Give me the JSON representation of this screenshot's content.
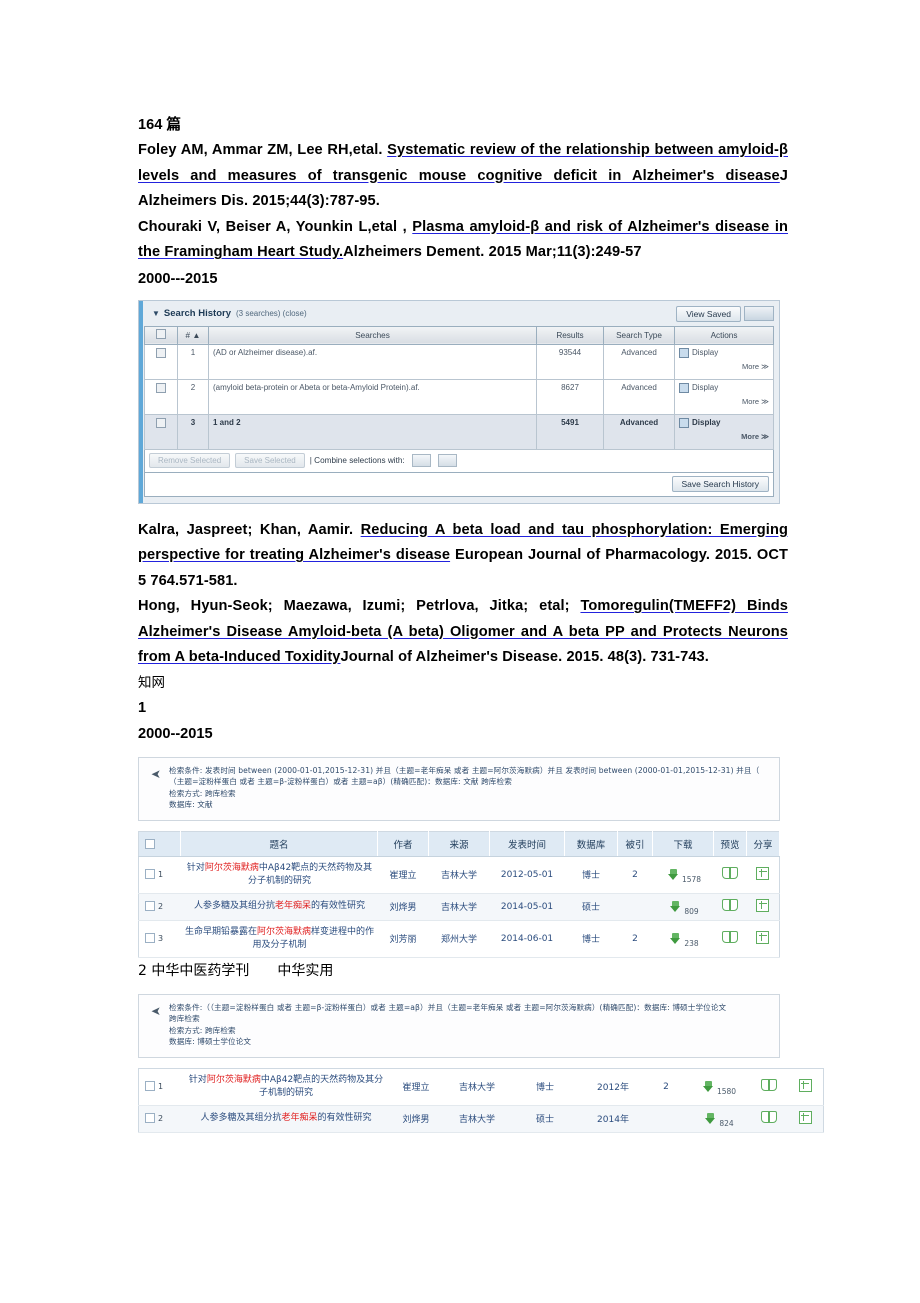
{
  "document": {
    "count_line": "164 篇",
    "year_range_1": "2000---2015",
    "zhiwang_label": "知网",
    "section_1_number": "1",
    "year_range_2": "2000--2015",
    "section_2_label": "2 中华中医药学刊　　中华实用"
  },
  "references": [
    {
      "id": "ref-foley",
      "authors": "Foley AM,  Ammar ZM,  Lee RH,etal. ",
      "title": "Systematic review of  the  relationship between amyloid-β levels and  measures of  transgenic mouse cognitive deficit in Alzheimer's disease",
      "citation": "J Alzheimers Dis. 2015;44(3):787-95."
    },
    {
      "id": "ref-chouraki",
      "authors": "Chouraki V,  Beiser A,  Younkin L,etal ,  ",
      "title": "Plasma amyloid-β  and  risk of Alzheimer's disease in the  Framingham Heart Study.",
      "citation": "Alzheimers Dement. 2015 Mar;11(3):249-57"
    },
    {
      "id": "ref-kalra",
      "authors": "Kalra, Jaspreet; Khan, Aamir. ",
      "title": "Reducing A  beta  load  and  tau  phosphorylation: Emerging perspective for   treating  Alzheimer's disease",
      "citation": " European Journal of Pharmacology. 2015. OCT 5 764.571-581."
    },
    {
      "id": "ref-hong",
      "authors": "Hong, Hyun-Seok; Maezawa, Izumi; Petrlova, Jitka; etal; ",
      "title": "Tomoregulin(TMEFF2) Binds Alzheimer's Disease Amyloid-beta (A beta)  Oligomer and  A beta  PP and Protects Neurons from A beta-Induced Toxidity",
      "citation": "Journal of Alzheimer's Disease. 2015. 48(3). 731-743."
    }
  ],
  "search_history": {
    "title": "Search History",
    "subtitle": "(3 searches) (close)",
    "caret_icon": "triangle-down-icon",
    "view_saved_label": "View Saved",
    "columns": [
      "",
      "#",
      "Searches",
      "Results",
      "Search Type",
      "Actions"
    ],
    "rows": [
      {
        "num": "1",
        "query": "(AD or Alzheimer disease).af.",
        "results": "93544",
        "type": "Advanced",
        "action": "Display",
        "more": "More ≫",
        "selected": false
      },
      {
        "num": "2",
        "query": "(amyloid beta-protein or Abeta or beta-Amyloid Protein).af.",
        "results": "8627",
        "type": "Advanced",
        "action": "Display",
        "more": "More ≫",
        "selected": false
      },
      {
        "num": "3",
        "query": "1 and 2",
        "results": "5491",
        "type": "Advanced",
        "action": "Display",
        "more": "More ≫",
        "selected": true
      }
    ],
    "footer": {
      "remove_selected": "Remove Selected",
      "save_selected": "Save Selected",
      "combine_label": "| Combine selections with:",
      "save_search_history": "Save Search History"
    }
  },
  "cnki_1": {
    "conditions": {
      "line1": "检索条件: 发表时间 between (2000-01-01,2015-12-31) 并且（主题=老年痴呆 或者 主题=阿尔茨海默病）并且 发表时间 between (2000-01-01,2015-12-31) 并且（",
      "line2": "（主题=淀粉样蛋白 或者 主题=β-淀粉样蛋白）或者 主题=aβ）(精确匹配)：数据库: 文献 跨库检索",
      "line3": "检索方式: 跨库检索",
      "line4": "数据库: 文献"
    },
    "columns": [
      "",
      "题名",
      "作者",
      "来源",
      "发表时间",
      "数据库",
      "被引",
      "下载",
      "预览",
      "分享"
    ],
    "rows": [
      {
        "idx": "1",
        "title_pre": "针对",
        "title_hl": "阿尔茨海默病",
        "title_post": "中Aβ42靶点的天然药物及其分子机制的研究",
        "author": "崔理立",
        "source": "吉林大学",
        "date": "2012-05-01",
        "db": "博士",
        "cited": "2",
        "downloads": "1578"
      },
      {
        "idx": "2",
        "title_pre": "人参多糖及其组分抗",
        "title_hl": "老年痴呆",
        "title_post": "的有效性研究",
        "author": "刘烨男",
        "source": "吉林大学",
        "date": "2014-05-01",
        "db": "硕士",
        "cited": "",
        "downloads": "809"
      },
      {
        "idx": "3",
        "title_pre": "生命早期铅暴露在",
        "title_hl": "阿尔茨海默病",
        "title_post": "样变进程中的作用及分子机制",
        "author": "刘芳丽",
        "source": "郑州大学",
        "date": "2014-06-01",
        "db": "博士",
        "cited": "2",
        "downloads": "238"
      }
    ]
  },
  "cnki_2": {
    "conditions": {
      "line1": "检索条件:（（主题=淀粉样蛋白 或者 主题=β-淀粉样蛋白）或者 主题=aβ）并且（主题=老年痴呆 或者 主题=阿尔茨海默病）(精确匹配)：数据库: 博硕士学位论文",
      "line2": "跨库检索",
      "line3": "检索方式: 跨库检索",
      "line4": "数据库: 博硕士学位论文"
    },
    "rows": [
      {
        "idx": "1",
        "title_pre": "针对",
        "title_hl": "阿尔茨海默病",
        "title_post": "中Aβ42靶点的天然药物及其分子机制的研究",
        "author": "崔理立",
        "source": "吉林大学",
        "db": "博士",
        "date": "2012年",
        "cited": "2",
        "downloads": "1580"
      },
      {
        "idx": "2",
        "title_pre": "人参多糖及其组分抗",
        "title_hl": "老年痴呆",
        "title_post": "的有效性研究",
        "author": "刘烨男",
        "source": "吉林大学",
        "db": "硕士",
        "date": "2014年",
        "cited": "",
        "downloads": "824"
      }
    ]
  },
  "icons": {
    "download": "download-icon",
    "preview": "book-preview-icon",
    "share": "plus-share-icon",
    "checkbox": "checkbox-icon",
    "cursor": "mouse-cursor-icon"
  }
}
